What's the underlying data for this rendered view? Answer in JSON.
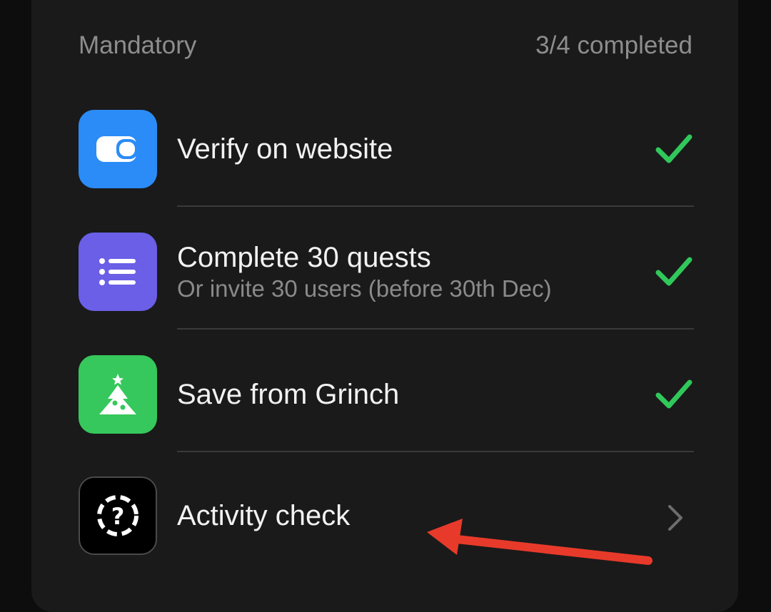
{
  "section": {
    "title": "Mandatory",
    "progress_text": "3/4 completed"
  },
  "tasks": [
    {
      "title": "Verify on website",
      "subtitle": "",
      "icon": "wallet-icon",
      "icon_bg": "#2b8cf7",
      "status": "completed"
    },
    {
      "title": "Complete 30 quests",
      "subtitle": "Or invite 30 users (before 30th Dec)",
      "icon": "list-icon",
      "icon_bg": "#6a5fe6",
      "status": "completed"
    },
    {
      "title": "Save from Grinch",
      "subtitle": "",
      "icon": "christmas-tree-icon",
      "icon_bg": "#36c85c",
      "status": "completed"
    },
    {
      "title": "Activity check",
      "subtitle": "",
      "icon": "question-icon",
      "icon_bg": "#000000",
      "status": "pending"
    }
  ],
  "colors": {
    "check": "#30c85a",
    "arrow_annotation": "#e83a2a"
  }
}
